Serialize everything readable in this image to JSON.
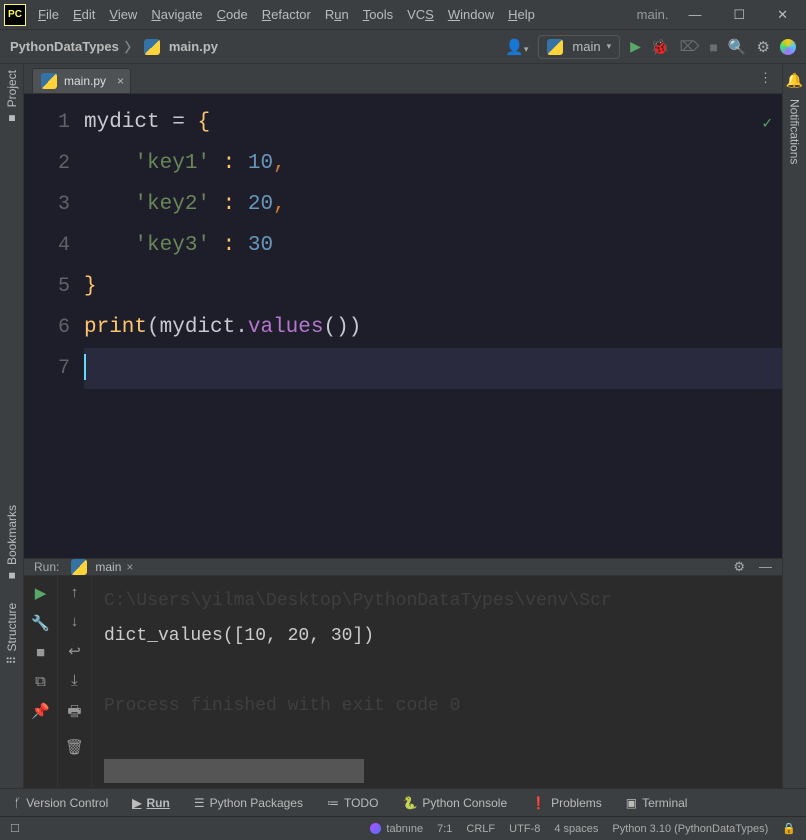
{
  "menu": {
    "file": "File",
    "edit": "Edit",
    "view": "View",
    "navigate": "Navigate",
    "code": "Code",
    "refactor": "Refactor",
    "run": "Run",
    "tools": "Tools",
    "vcs": "VCS",
    "window": "Window",
    "help": "Help"
  },
  "title_filename": "main.",
  "breadcrumb": {
    "project": "PythonDataTypes",
    "file": "main.py"
  },
  "config": {
    "label": "main"
  },
  "tabs": [
    {
      "label": "main.py"
    }
  ],
  "gutter_lines": [
    "1",
    "2",
    "3",
    "4",
    "5",
    "6",
    "7"
  ],
  "code": {
    "l1_var": "mydict",
    "l1_eq": " = ",
    "l1_b": "{",
    "l2_s": "'key1'",
    "l2_c": " :",
    "l2_n": " 10",
    "l2_cm": ",",
    "l3_s": "'key2'",
    "l3_c": " :",
    "l3_n": " 20",
    "l3_cm": ",",
    "l4_s": "'key3'",
    "l4_c": " :",
    "l4_n": " 30",
    "l5_b": "}",
    "l6_fn": "print",
    "l6_p1": "(",
    "l6_var": "mydict",
    "l6_dot": ".",
    "l6_m": "values",
    "l6_p2": "(",
    "l6_p3": ")",
    "l6_p4": ")"
  },
  "run": {
    "label": "Run:",
    "tab": "main",
    "console_path": "C:\\Users\\yilma\\Desktop\\PythonDataTypes\\venv\\Scr",
    "output": "dict_values([10, 20, 30])",
    "exit": "Process finished with exit code 0"
  },
  "left_rail": {
    "project": "Project",
    "bookmarks": "Bookmarks",
    "structure": "Structure"
  },
  "right_rail": {
    "notifications": "Notifications"
  },
  "bottom": {
    "vc": "Version Control",
    "run": "Run",
    "pkg": "Python Packages",
    "todo": "TODO",
    "console": "Python Console",
    "problems": "Problems",
    "terminal": "Terminal"
  },
  "status": {
    "tabnine": "tabnıne",
    "pos": "7:1",
    "eol": "CRLF",
    "enc": "UTF-8",
    "indent": "4 spaces",
    "interp": "Python 3.10 (PythonDataTypes)"
  }
}
